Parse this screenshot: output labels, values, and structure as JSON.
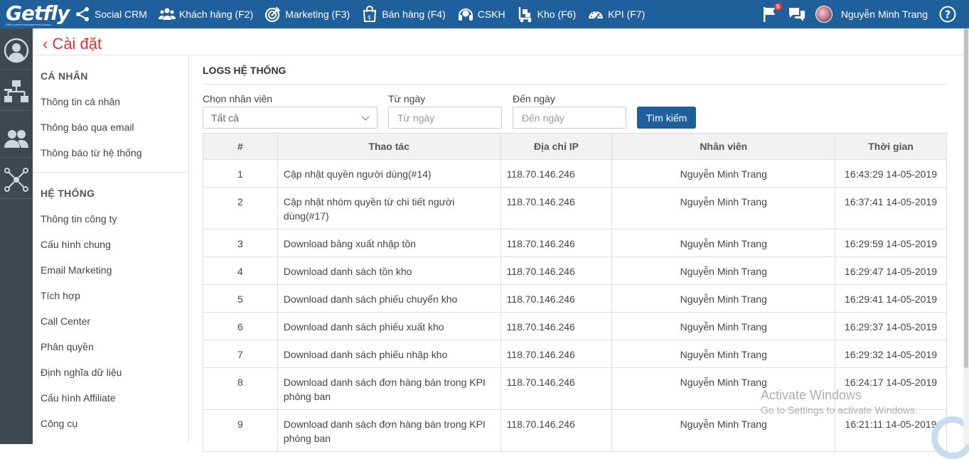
{
  "brand": {
    "logo_text": "Getfly",
    "logo_tagline": "SME's perfect management solution"
  },
  "nav": {
    "items": [
      {
        "label": "Social CRM",
        "icon": "share-icon"
      },
      {
        "label": "Khách hàng (F2)",
        "icon": "users-icon"
      },
      {
        "label": "Marketing (F3)",
        "icon": "target-icon"
      },
      {
        "label": "Bán hàng (F4)",
        "icon": "shopping-bag-icon"
      },
      {
        "label": "CSKH",
        "icon": "headset-icon"
      },
      {
        "label": "Kho (F6)",
        "icon": "hand-truck-icon"
      },
      {
        "label": "KPI (F7)",
        "icon": "gauge-icon"
      }
    ]
  },
  "topright": {
    "notification_count": "5",
    "user_name": "Nguyễn Minh Trang"
  },
  "page": {
    "back_label": "‹ Cài đặt"
  },
  "sidebar": {
    "personal_title": "CÁ NHÂN",
    "personal_items": [
      "Thông tin cá nhân",
      "Thông báo qua email",
      "Thông báo từ hệ thống"
    ],
    "system_title": "HỆ THỐNG",
    "system_items": [
      "Thông tin công ty",
      "Cấu hình chung",
      "Email Marketing",
      "Tích hợp",
      "Call Center",
      "Phân quyền",
      "Định nghĩa dữ liệu",
      "Cấu hình Affiliate",
      "Công cụ"
    ]
  },
  "logs": {
    "title": "LOGS HỆ THỐNG",
    "filter": {
      "employee_label": "Chọn nhân viên",
      "employee_value": "Tất cả",
      "from_label": "Từ ngày",
      "from_placeholder": "Từ ngày",
      "to_label": "Đến ngày",
      "to_placeholder": "Đến ngày",
      "search_button": "Tìm kiếm"
    },
    "columns": [
      "#",
      "Thao tác",
      "Địa chỉ IP",
      "Nhân viên",
      "Thời gian"
    ],
    "rows": [
      {
        "no": "1",
        "action": "Cập nhật quyền người dùng(#14)",
        "ip": "118.70.146.246",
        "employee": "Nguyễn Minh Trang",
        "time": "16:43:29 14-05-2019"
      },
      {
        "no": "2",
        "action": "Cập nhật nhóm quyền từ chi tiết người dùng(#17)",
        "ip": "118.70.146.246",
        "employee": "Nguyễn Minh Trang",
        "time": "16:37:41 14-05-2019"
      },
      {
        "no": "3",
        "action": "Download bảng xuất nhập tồn",
        "ip": "118.70.146.246",
        "employee": "Nguyễn Minh Trang",
        "time": "16:29:59 14-05-2019"
      },
      {
        "no": "4",
        "action": "Download danh sách tồn kho",
        "ip": "118.70.146.246",
        "employee": "Nguyễn Minh Trang",
        "time": "16:29:47 14-05-2019"
      },
      {
        "no": "5",
        "action": "Download danh sách phiếu chuyển kho",
        "ip": "118.70.146.246",
        "employee": "Nguyễn Minh Trang",
        "time": "16:29:41 14-05-2019"
      },
      {
        "no": "6",
        "action": "Download danh sách phiếu xuất kho",
        "ip": "118.70.146.246",
        "employee": "Nguyễn Minh Trang",
        "time": "16:29:37 14-05-2019"
      },
      {
        "no": "7",
        "action": "Download danh sách phiếu nhập kho",
        "ip": "118.70.146.246",
        "employee": "Nguyễn Minh Trang",
        "time": "16:29:32 14-05-2019"
      },
      {
        "no": "8",
        "action": "Download danh sách đơn hàng bán trong KPI phòng ban",
        "ip": "118.70.146.246",
        "employee": "Nguyễn Minh Trang",
        "time": "16:24:17 14-05-2019"
      },
      {
        "no": "9",
        "action": "Download danh sách đơn hàng bán trong KPI phòng ban",
        "ip": "118.70.146.246",
        "employee": "Nguyễn Minh Trang",
        "time": "16:21:11 14-05-2019"
      }
    ]
  },
  "watermark": {
    "line1": "Activate Windows",
    "line2": "Go to Settings to activate Windows."
  }
}
